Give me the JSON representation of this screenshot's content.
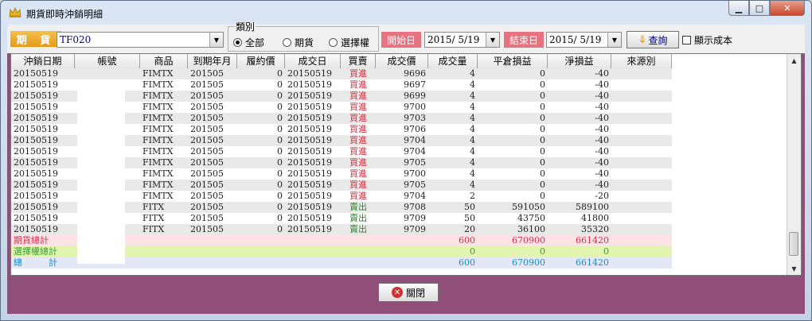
{
  "window": {
    "title": "期貨即時沖銷明細"
  },
  "toolbar": {
    "kind_label": "期 貨",
    "account_value": "TF020",
    "group_title": "類別",
    "radios": [
      {
        "label": "全部",
        "checked": true
      },
      {
        "label": "期貨",
        "checked": false
      },
      {
        "label": "選擇權",
        "checked": false
      }
    ],
    "start_label": "開始日",
    "start_value": "2015/ 5/19",
    "end_label": "結束日",
    "end_value": "2015/ 5/19",
    "query_label": "查詢",
    "show_cost_label": "顯示成本"
  },
  "grid": {
    "columns": [
      "沖銷日期",
      "帳號",
      "商品",
      "到期年月",
      "履約價",
      "成交日",
      "買賣",
      "成交價",
      "成交量",
      "平倉損益",
      "淨損益",
      "來源別"
    ],
    "rows": [
      [
        "20150519",
        "",
        "FIMTX",
        "201505",
        "0",
        "20150519",
        "買進",
        "9696",
        "4",
        "0",
        "-40",
        ""
      ],
      [
        "20150519",
        "",
        "FIMTX",
        "201505",
        "0",
        "20150519",
        "買進",
        "9697",
        "4",
        "0",
        "-40",
        ""
      ],
      [
        "20150519",
        "",
        "FIMTX",
        "201505",
        "0",
        "20150519",
        "買進",
        "9699",
        "4",
        "0",
        "-40",
        ""
      ],
      [
        "20150519",
        "",
        "FIMTX",
        "201505",
        "0",
        "20150519",
        "買進",
        "9700",
        "4",
        "0",
        "-40",
        ""
      ],
      [
        "20150519",
        "",
        "FIMTX",
        "201505",
        "0",
        "20150519",
        "買進",
        "9703",
        "4",
        "0",
        "-40",
        ""
      ],
      [
        "20150519",
        "",
        "FIMTX",
        "201505",
        "0",
        "20150519",
        "買進",
        "9706",
        "4",
        "0",
        "-40",
        ""
      ],
      [
        "20150519",
        "",
        "FIMTX",
        "201505",
        "0",
        "20150519",
        "買進",
        "9704",
        "4",
        "0",
        "-40",
        ""
      ],
      [
        "20150519",
        "",
        "FIMTX",
        "201505",
        "0",
        "20150519",
        "買進",
        "9704",
        "4",
        "0",
        "-40",
        ""
      ],
      [
        "20150519",
        "",
        "FIMTX",
        "201505",
        "0",
        "20150519",
        "買進",
        "9705",
        "4",
        "0",
        "-40",
        ""
      ],
      [
        "20150519",
        "",
        "FIMTX",
        "201505",
        "0",
        "20150519",
        "買進",
        "9700",
        "4",
        "0",
        "-40",
        ""
      ],
      [
        "20150519",
        "",
        "FIMTX",
        "201505",
        "0",
        "20150519",
        "買進",
        "9705",
        "4",
        "0",
        "-40",
        ""
      ],
      [
        "20150519",
        "",
        "FIMTX",
        "201505",
        "0",
        "20150519",
        "買進",
        "9704",
        "2",
        "0",
        "-20",
        ""
      ],
      [
        "20150519",
        "",
        "FITX",
        "201505",
        "0",
        "20150519",
        "賣出",
        "9708",
        "50",
        "591050",
        "589100",
        ""
      ],
      [
        "20150519",
        "",
        "FITX",
        "201505",
        "0",
        "20150519",
        "賣出",
        "9709",
        "50",
        "43750",
        "41800",
        ""
      ],
      [
        "20150519",
        "",
        "FITX",
        "201505",
        "0",
        "20150519",
        "賣出",
        "9709",
        "20",
        "36100",
        "35320",
        ""
      ]
    ],
    "summaries": [
      {
        "label": "期貨總計",
        "qty": "600",
        "pnl": "670900",
        "net": "661420",
        "kind": "sum-fut"
      },
      {
        "label": "選擇權總計",
        "qty": "0",
        "pnl": "0",
        "net": "0",
        "kind": "sum-opt"
      },
      {
        "label": "總　　　計",
        "qty": "600",
        "pnl": "670900",
        "net": "661420",
        "kind": "sum-all"
      }
    ]
  },
  "footer": {
    "close_label": "關閉"
  },
  "colors": {
    "client_bg": "#8f4f78",
    "kind_label": "#e69a1a",
    "date_label": "#e57480",
    "buy": "#d03040",
    "sell": "#2a8a2a"
  }
}
